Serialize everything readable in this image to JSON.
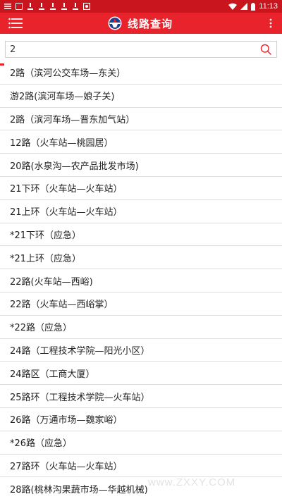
{
  "status_bar": {
    "time": "11:13",
    "icons": [
      "menu-icon",
      "box-icon",
      "download-icon",
      "download-icon",
      "download-icon",
      "download-icon",
      "download-icon",
      "picture-icon",
      "wifi-icon",
      "signal-icon",
      "battery-icon"
    ]
  },
  "app_bar": {
    "title": "线路查询",
    "color": "#e8232b"
  },
  "search": {
    "value": "2",
    "placeholder": ""
  },
  "routes": [
    "2路（滨河公交车场—东关）",
    "游2路(滨河车场—娘子关)",
    "2路（滨河车场—晋东加气站）",
    "12路（火车站—桃园居）",
    "20路(水泉沟—农产品批发市场)",
    "21下环（火车站—火车站）",
    "21上环（火车站—火车站）",
    "*21下环（应急）",
    "*21上环（应急）",
    "22路(火车站—西峪)",
    "22路（火车站—西峪掌）",
    "*22路（应急）",
    "24路（工程技术学院—阳光小区）",
    "24路区（工商大厦）",
    "25路环（工程技术学院—火车站）",
    "26路（万通市场—魏家峪）",
    "*26路（应急）",
    "27路环（火车站—火车站）",
    "28路(桃林沟果蔬市场—华越机械)"
  ],
  "watermark": "www.ZXXY.COM"
}
